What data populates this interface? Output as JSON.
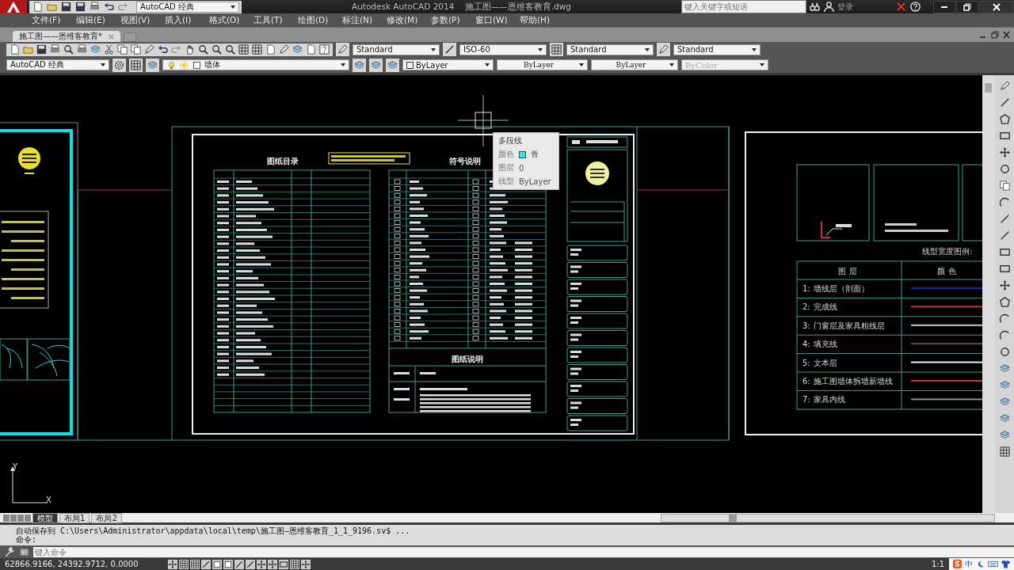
{
  "title_bar": {
    "workspace": "AutoCAD 经典",
    "app": "Autodesk AutoCAD 2014",
    "file": "施工图——恩维客教育.dwg",
    "search": {
      "placeholder": "键入关键字或短语"
    },
    "sign_in": "登录"
  },
  "menu": [
    "文件(F)",
    "编辑(E)",
    "视图(V)",
    "插入(I)",
    "格式(O)",
    "工具(T)",
    "绘图(D)",
    "标注(N)",
    "修改(M)",
    "参数(P)",
    "窗口(W)",
    "帮助(H)"
  ],
  "doc_tabs": [
    {
      "label": "施工图——恩维客教育*",
      "selected": true
    }
  ],
  "styles_toolbar": {
    "text_style": "Standard",
    "dim_style": "ISO-60",
    "table_style": "Standard",
    "mleader_style": "Standard"
  },
  "properties_bar": {
    "workspace": "AutoCAD 经典",
    "layer": "墙体",
    "color_setting": "ByLayer",
    "linetype": "ByLayer",
    "lineweight": "ByLayer",
    "plot_style": {
      "value": "ByColor",
      "disabled": true
    }
  },
  "drawing": {
    "list_title": "图纸目录",
    "symbols_title": "符号说明",
    "notes_title": "图纸说明",
    "legend_title": "线型宽度图例:",
    "legend_headers": [
      "图 层",
      "颜 色"
    ],
    "legend_rows": [
      {
        "no": "1:",
        "name": "墙线层（剖面）",
        "color": "#2020b0"
      },
      {
        "no": "2:",
        "name": "完成线",
        "color": "#c03040"
      },
      {
        "no": "3:",
        "name": "门窗层及家具粗线层",
        "color": "#c8c8c8"
      },
      {
        "no": "4:",
        "name": "填充线",
        "color": "#505050"
      },
      {
        "no": "5:",
        "name": "文本层",
        "color": "#f0f0f0"
      },
      {
        "no": "6:",
        "name": "施工图墙体拆墙新墙线",
        "color": "#c03040"
      },
      {
        "no": "7:",
        "name": "家具内线",
        "color": "#909090"
      }
    ],
    "ucs": {
      "x": "X",
      "y": "Y"
    }
  },
  "tooltip": {
    "title": "多段线",
    "rows": [
      {
        "label": "颜色",
        "value": "青",
        "color": "#40e0e0"
      },
      {
        "label": "图层",
        "value": "0"
      },
      {
        "label": "线型",
        "value": "ByLayer"
      }
    ]
  },
  "layout_tabs": [
    {
      "label": "模型",
      "selected": true
    },
    {
      "label": "布局1",
      "selected": false
    },
    {
      "label": "布局2",
      "selected": false
    }
  ],
  "command_history": [
    "自动保存到 C:\\Users\\Administrator\\appdata\\local\\temp\\施工图—恩维客教育_1_1_9196.sv$ ...",
    "命令:"
  ],
  "command_input": {
    "placeholder": "键入命令"
  },
  "status_bar": {
    "coordinates": "62866.9166, 24392.9712, 0.0000",
    "annotation_scale": "1:1",
    "ime": "中"
  }
}
